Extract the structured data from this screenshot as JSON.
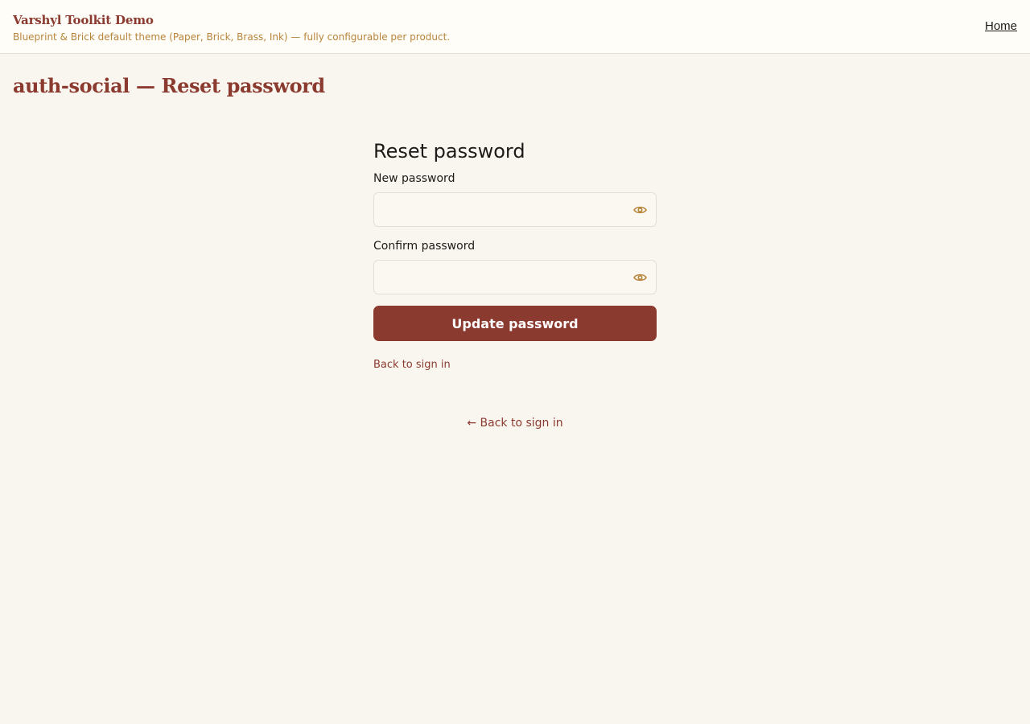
{
  "header": {
    "title": "Varshyl Toolkit Demo",
    "subtitle": "Blueprint & Brick default theme (Paper, Brick, Brass, Ink) — fully configurable per product.",
    "nav_home": "Home"
  },
  "page": {
    "title": "auth-social — Reset password"
  },
  "form": {
    "heading": "Reset password",
    "new_password": {
      "label": "New password",
      "value": "",
      "icon": "eye-icon"
    },
    "confirm_password": {
      "label": "Confirm password",
      "value": "",
      "icon": "eye-icon"
    },
    "submit_label": "Update password",
    "back_link": "Back to sign in"
  },
  "footer": {
    "back_link": "← Back to sign in"
  },
  "colors": {
    "brick": "#8b3a2f",
    "brass": "#b8843a",
    "ink": "#1f1a17",
    "paper": "#f9f6f0"
  }
}
